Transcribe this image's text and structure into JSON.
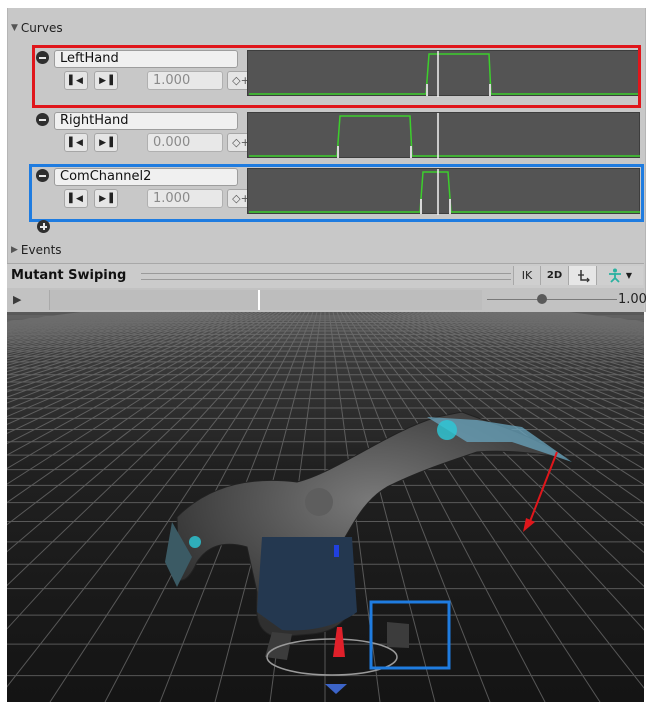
{
  "curves_section": {
    "label": "Curves",
    "icon": "triangle-down-icon"
  },
  "curves": [
    {
      "name": "LeftHand",
      "value": "1.000",
      "highlight": "red"
    },
    {
      "name": "RightHand",
      "value": "0.000",
      "highlight": "none"
    },
    {
      "name": "ComChannel2",
      "value": "1.000",
      "highlight": "blue"
    }
  ],
  "events_section": {
    "label": "Events",
    "icon": "triangle-right-icon"
  },
  "preview": {
    "title": "Mutant Swiping",
    "buttons": {
      "ik": "IK",
      "twod": "2D"
    },
    "speed_value": "1.00",
    "speed_fraction": 0.42
  },
  "colors": {
    "highlight_red": "#e0161b",
    "highlight_blue": "#1f7ce0",
    "curve_green": "#3ccf2c",
    "graph_bg": "#545454",
    "panel_bg": "#c8c8c8"
  }
}
